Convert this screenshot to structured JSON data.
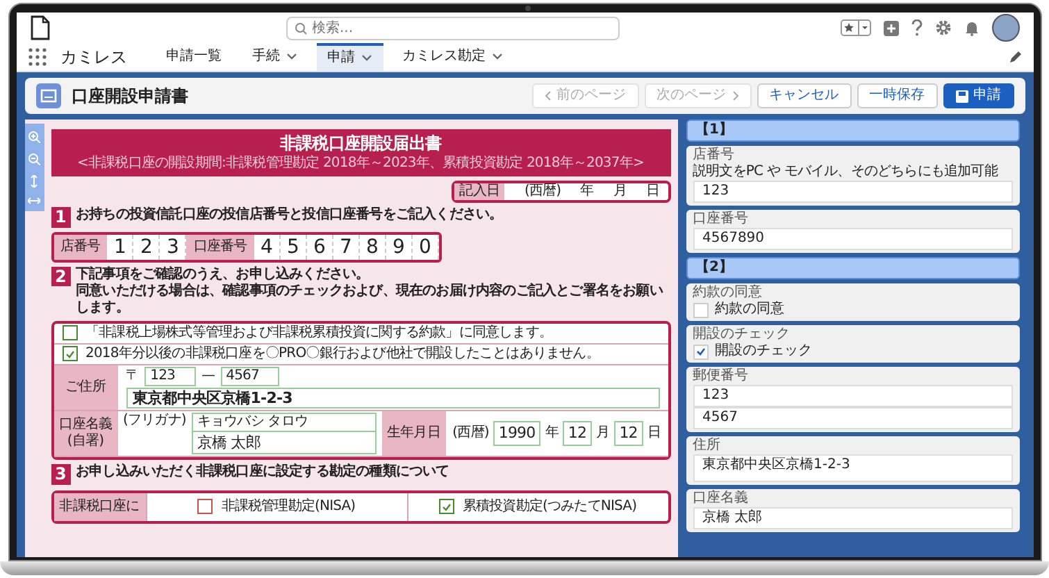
{
  "header": {
    "search_placeholder": "検索..."
  },
  "nav": {
    "app_name": "カミレス",
    "tabs": [
      {
        "label": "申請一覧",
        "selected": false,
        "has_menu": false
      },
      {
        "label": "手続",
        "selected": false,
        "has_menu": true
      },
      {
        "label": "申請",
        "selected": true,
        "has_menu": true
      },
      {
        "label": "カミレス勘定",
        "selected": false,
        "has_menu": true
      }
    ]
  },
  "page_header": {
    "title": "口座開設申請書",
    "buttons": [
      {
        "label": "前のページ",
        "kind": "prev",
        "disabled": true
      },
      {
        "label": "次のページ",
        "kind": "next",
        "disabled": true
      },
      {
        "label": "キャンセル",
        "kind": "default",
        "disabled": false
      },
      {
        "label": "一時保存",
        "kind": "default",
        "disabled": false
      },
      {
        "label": "申請",
        "kind": "primary",
        "disabled": false
      }
    ]
  },
  "form": {
    "title": "非課税口座開設届出書",
    "subtitle": "<非課税口座の開設期間:非課税管理勘定 2018年～2023年、累積投資勘定 2018年～2037年>",
    "date": {
      "label": "記入日",
      "era": "(西暦)",
      "units": [
        "年",
        "月",
        "日"
      ]
    },
    "section1": {
      "number": "1",
      "heading": "お持ちの投資信託口座の投信店番号と投信口座番号をご記入ください。",
      "branch_label": "店番号",
      "branch_digits": [
        "1",
        "2",
        "3"
      ],
      "account_label": "口座番号",
      "account_digits": [
        "4",
        "5",
        "6",
        "7",
        "8",
        "9",
        "0"
      ]
    },
    "section2": {
      "number": "2",
      "heading": [
        "下記事項をご確認のうえ、お申し込みください。",
        "同意いただける場合は、確認事項のチェックおよび、現在のお届け内容のご記入とご署名をお願いします。"
      ],
      "agreements": [
        {
          "text": "「非課税上場株式等管理および非課税累積投資に関する約款」に同意します。",
          "checked": false
        },
        {
          "text": "2018年分以後の非課税口座を〇PRO〇銀行および他社で開設したことはありません。",
          "checked": true
        }
      ],
      "address": {
        "label": "ご住所",
        "postal_mark": "〒",
        "postal": [
          "123",
          "4567"
        ],
        "separator": "—",
        "value": "東京都中央区京橋1-2-3"
      },
      "name": {
        "label": "口座名義",
        "sublabel": "(自署)",
        "furigana_label": "(フリガナ)",
        "furigana": "キョウバシ タロウ",
        "value": "京橋 太郎"
      },
      "birth": {
        "label": "生年月日",
        "era": "(西暦)",
        "parts": [
          {
            "value": "1990",
            "unit": "年"
          },
          {
            "value": "12",
            "unit": "月"
          },
          {
            "value": "12",
            "unit": "日"
          }
        ]
      }
    },
    "section3": {
      "number": "3",
      "heading": "お申し込みいただく非課税口座に設定する勘定の種類について",
      "row_label": "非課税口座に",
      "options": [
        {
          "text": "非課税管理勘定(NISA)",
          "checked": false
        },
        {
          "text": "累積投資勘定(つみたてNISA)",
          "checked": true
        }
      ]
    }
  },
  "side": {
    "sections": [
      {
        "heading": "【1】",
        "fields": [
          {
            "kind": "text",
            "label": "店番号",
            "help": "説明文をPC や モバイル、そのどちらにも追加可能",
            "values": [
              "123"
            ]
          },
          {
            "kind": "text",
            "label": "口座番号",
            "values": [
              "4567890"
            ]
          }
        ]
      },
      {
        "heading": "【2】",
        "fields": [
          {
            "kind": "checkbox",
            "label": "約款の同意",
            "option": "約款の同意",
            "checked": false
          },
          {
            "kind": "checkbox",
            "label": "開設のチェック",
            "option": "開設のチェック",
            "checked": true
          },
          {
            "kind": "text",
            "label": "郵便番号",
            "values": [
              "123",
              "4567"
            ]
          },
          {
            "kind": "textarea",
            "label": "住所",
            "values": [
              "東京都中央区京橋1-2-3"
            ]
          },
          {
            "kind": "text",
            "label": "口座名義",
            "values": [
              "京橋 太郎"
            ]
          }
        ]
      }
    ]
  }
}
